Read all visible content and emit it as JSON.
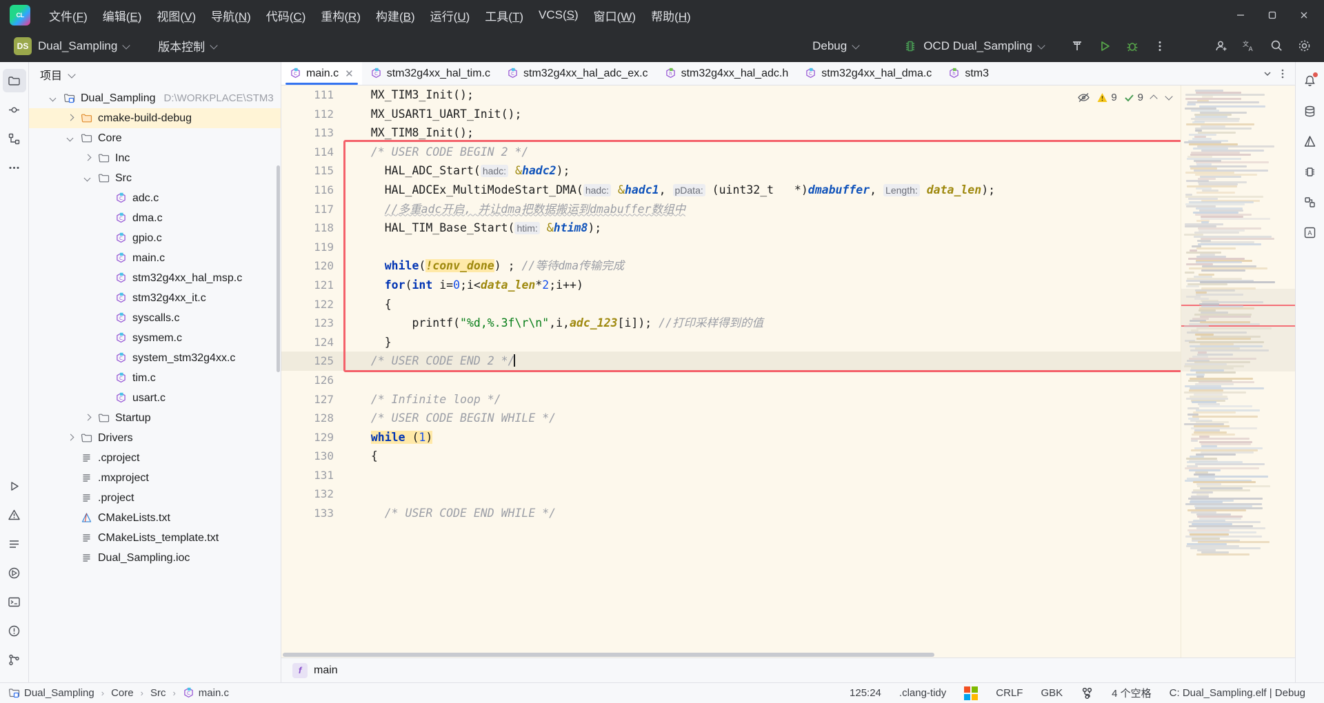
{
  "app": {
    "logo_text": "CL",
    "title": "Dual_Sampling"
  },
  "menubar": {
    "items": [
      {
        "label": "文件(F)",
        "mnemonic": "F"
      },
      {
        "label": "编辑(E)",
        "mnemonic": "E"
      },
      {
        "label": "视图(V)",
        "mnemonic": "V"
      },
      {
        "label": "导航(N)",
        "mnemonic": "N"
      },
      {
        "label": "代码(C)",
        "mnemonic": "C"
      },
      {
        "label": "重构(R)",
        "mnemonic": "R"
      },
      {
        "label": "构建(B)",
        "mnemonic": "B"
      },
      {
        "label": "运行(U)",
        "mnemonic": "U"
      },
      {
        "label": "工具(T)",
        "mnemonic": "T"
      },
      {
        "label": "VCS(S)",
        "mnemonic": "S"
      },
      {
        "label": "窗口(W)",
        "mnemonic": "W"
      },
      {
        "label": "帮助(H)",
        "mnemonic": "H"
      }
    ],
    "window_controls": {
      "minimize": "minimize-icon",
      "maximize": "maximize-icon",
      "close": "close-icon"
    }
  },
  "toolbar": {
    "project_badge": "DS",
    "project_name": "Dual_Sampling",
    "vcs_label": "版本控制",
    "build_config": "Debug",
    "run_config": "OCD Dual_Sampling",
    "run_config_icon": "microcontroller-icon",
    "buttons": {
      "build": "hammer-icon",
      "run": "run-icon",
      "debug": "debug-icon",
      "more": "more-options-icon",
      "account": "account-icon",
      "translate": "translate-icon",
      "search": "search-icon",
      "settings": "settings-icon"
    }
  },
  "project_panel": {
    "title": "项目",
    "tree": [
      {
        "depth": 0,
        "label": "Dual_Sampling",
        "path": "D:\\WORKPLACE\\STM3",
        "icon": "project-root-icon",
        "arrow": "down",
        "selected": false
      },
      {
        "depth": 1,
        "label": "cmake-build-debug",
        "path": "",
        "icon": "folder-orange-icon",
        "arrow": "right",
        "selected": true
      },
      {
        "depth": 1,
        "label": "Core",
        "path": "",
        "icon": "folder-icon",
        "arrow": "down",
        "selected": false
      },
      {
        "depth": 2,
        "label": "Inc",
        "path": "",
        "icon": "folder-icon",
        "arrow": "right",
        "selected": false
      },
      {
        "depth": 2,
        "label": "Src",
        "path": "",
        "icon": "folder-icon",
        "arrow": "down",
        "selected": false
      },
      {
        "depth": 3,
        "label": "adc.c",
        "path": "",
        "icon": "c-file-icon",
        "arrow": "",
        "selected": false
      },
      {
        "depth": 3,
        "label": "dma.c",
        "path": "",
        "icon": "c-file-icon",
        "arrow": "",
        "selected": false
      },
      {
        "depth": 3,
        "label": "gpio.c",
        "path": "",
        "icon": "c-file-icon",
        "arrow": "",
        "selected": false
      },
      {
        "depth": 3,
        "label": "main.c",
        "path": "",
        "icon": "c-file-icon",
        "arrow": "",
        "selected": false
      },
      {
        "depth": 3,
        "label": "stm32g4xx_hal_msp.c",
        "path": "",
        "icon": "c-file-icon",
        "arrow": "",
        "selected": false
      },
      {
        "depth": 3,
        "label": "stm32g4xx_it.c",
        "path": "",
        "icon": "c-file-icon",
        "arrow": "",
        "selected": false
      },
      {
        "depth": 3,
        "label": "syscalls.c",
        "path": "",
        "icon": "c-file-icon",
        "arrow": "",
        "selected": false
      },
      {
        "depth": 3,
        "label": "sysmem.c",
        "path": "",
        "icon": "c-file-icon",
        "arrow": "",
        "selected": false
      },
      {
        "depth": 3,
        "label": "system_stm32g4xx.c",
        "path": "",
        "icon": "c-file-icon",
        "arrow": "",
        "selected": false
      },
      {
        "depth": 3,
        "label": "tim.c",
        "path": "",
        "icon": "c-file-icon",
        "arrow": "",
        "selected": false
      },
      {
        "depth": 3,
        "label": "usart.c",
        "path": "",
        "icon": "c-file-icon",
        "arrow": "",
        "selected": false
      },
      {
        "depth": 2,
        "label": "Startup",
        "path": "",
        "icon": "folder-icon",
        "arrow": "right",
        "selected": false
      },
      {
        "depth": 1,
        "label": "Drivers",
        "path": "",
        "icon": "folder-icon",
        "arrow": "right",
        "selected": false
      },
      {
        "depth": 1,
        "label": ".cproject",
        "path": "",
        "icon": "text-file-icon",
        "arrow": "",
        "selected": false
      },
      {
        "depth": 1,
        "label": ".mxproject",
        "path": "",
        "icon": "text-file-icon",
        "arrow": "",
        "selected": false
      },
      {
        "depth": 1,
        "label": ".project",
        "path": "",
        "icon": "text-file-icon",
        "arrow": "",
        "selected": false
      },
      {
        "depth": 1,
        "label": "CMakeLists.txt",
        "path": "",
        "icon": "cmake-file-icon",
        "arrow": "",
        "selected": false
      },
      {
        "depth": 1,
        "label": "CMakeLists_template.txt",
        "path": "",
        "icon": "text-file-icon",
        "arrow": "",
        "selected": false
      },
      {
        "depth": 1,
        "label": "Dual_Sampling.ioc",
        "path": "",
        "icon": "text-file-icon",
        "arrow": "",
        "selected": false
      }
    ]
  },
  "editor": {
    "tabs": [
      {
        "label": "main.c",
        "icon": "c-file-icon",
        "active": true,
        "closable": true
      },
      {
        "label": "stm32g4xx_hal_tim.c",
        "icon": "c-file-icon",
        "active": false,
        "closable": false
      },
      {
        "label": "stm32g4xx_hal_adc_ex.c",
        "icon": "c-file-icon",
        "active": false,
        "closable": false
      },
      {
        "label": "stm32g4xx_hal_adc.h",
        "icon": "h-file-icon",
        "active": false,
        "closable": false
      },
      {
        "label": "stm32g4xx_hal_dma.c",
        "icon": "c-file-icon",
        "active": false,
        "closable": false
      },
      {
        "label": "stm3",
        "icon": "h-file-icon",
        "active": false,
        "closable": false
      }
    ],
    "tabs_overflow_icon": "chevron-down-icon",
    "tabs_more_icon": "more-options-icon",
    "inspections": {
      "hide_icon": "eye-off-icon",
      "warning_icon": "warning-icon",
      "warning_count": "9",
      "ok_icon": "check-icon",
      "ok_count": "9",
      "prev_icon": "chevron-up-icon",
      "next_icon": "chevron-down-icon"
    },
    "first_line_number": 111,
    "lines": [
      {
        "n": 111,
        "text": "  MX_TIM3_Init();"
      },
      {
        "n": 112,
        "text": "  MX_USART1_UART_Init();"
      },
      {
        "n": 113,
        "text": "  MX_TIM8_Init();"
      },
      {
        "n": 114,
        "text": "  /* USER CODE BEGIN 2 */"
      },
      {
        "n": 115,
        "text": "    HAL_ADC_Start( hadc: &hadc2);"
      },
      {
        "n": 116,
        "text": "    HAL_ADCEx_MultiModeStart_DMA( hadc: &hadc1, pData: (uint32_t   *)dmabuffer, Length: data_len);"
      },
      {
        "n": 117,
        "text": "    //多重adc开启, 并让dma把数据搬运到dmabuffer数组中"
      },
      {
        "n": 118,
        "text": "    HAL_TIM_Base_Start( htim: &htim8);"
      },
      {
        "n": 119,
        "text": ""
      },
      {
        "n": 120,
        "text": "    while(!conv_done) ; //等待dma传输完成"
      },
      {
        "n": 121,
        "text": "    for(int i=0;i<data_len*2;i++)"
      },
      {
        "n": 122,
        "text": "    {"
      },
      {
        "n": 123,
        "text": "        printf(\"%d,%.3f\\r\\n\",i,adc_123[i]); //打印采样得到的值"
      },
      {
        "n": 124,
        "text": "    }"
      },
      {
        "n": 125,
        "text": "  /* USER CODE END 2 */"
      },
      {
        "n": 126,
        "text": ""
      },
      {
        "n": 127,
        "text": "  /* Infinite loop */"
      },
      {
        "n": 128,
        "text": "  /* USER CODE BEGIN WHILE */"
      },
      {
        "n": 129,
        "text": "  while (1)"
      },
      {
        "n": 130,
        "text": "  {"
      },
      {
        "n": 131,
        "text": ""
      },
      {
        "n": 132,
        "text": ""
      },
      {
        "n": 133,
        "text": "    /* USER CODE END WHILE */"
      }
    ],
    "highlight_box": {
      "from_line": 114,
      "to_line": 125,
      "color": "#f4616a"
    },
    "breadcrumb_function": "main",
    "breadcrumb_icon": "function-icon"
  },
  "status_bar": {
    "breadcrumb": [
      {
        "label": "Dual_Sampling",
        "icon": "project-root-icon"
      },
      {
        "label": "Core",
        "icon": ""
      },
      {
        "label": "Src",
        "icon": ""
      },
      {
        "label": "main.c",
        "icon": "c-file-icon"
      }
    ],
    "caret_position": "125:24",
    "inspection_profile": ".clang-tidy",
    "os_icon": "windows-icon",
    "line_separator": "CRLF",
    "encoding": "GBK",
    "vcs_icon": "branch-icon",
    "indent": "4 个空格",
    "run_target": "C: Dual_Sampling.elf | Debug"
  },
  "left_rail": {
    "items": [
      {
        "name": "project-tool-icon"
      },
      {
        "name": "commit-tool-icon"
      },
      {
        "name": "structure-tool-icon"
      },
      {
        "name": "more-tools-icon"
      },
      {
        "name": "run-tool-icon"
      },
      {
        "name": "problems-tool-icon"
      },
      {
        "name": "todo-tool-icon"
      },
      {
        "name": "services-tool-icon"
      },
      {
        "name": "terminal-tool-icon"
      },
      {
        "name": "notifications-tool-icon"
      },
      {
        "name": "git-tool-icon"
      }
    ]
  },
  "right_rail": {
    "items": [
      {
        "name": "notifications-icon"
      },
      {
        "name": "database-icon"
      },
      {
        "name": "cmake-icon"
      },
      {
        "name": "embedded-gdb-icon"
      },
      {
        "name": "peripherals-icon"
      },
      {
        "name": "ai-assistant-icon"
      }
    ]
  },
  "colors": {
    "accent": "#3574f0",
    "editor_bg": "#fdf8ec",
    "highlight_box": "#f4616a",
    "selection": "#fff4d6",
    "chrome_dark": "#2b2d30"
  }
}
